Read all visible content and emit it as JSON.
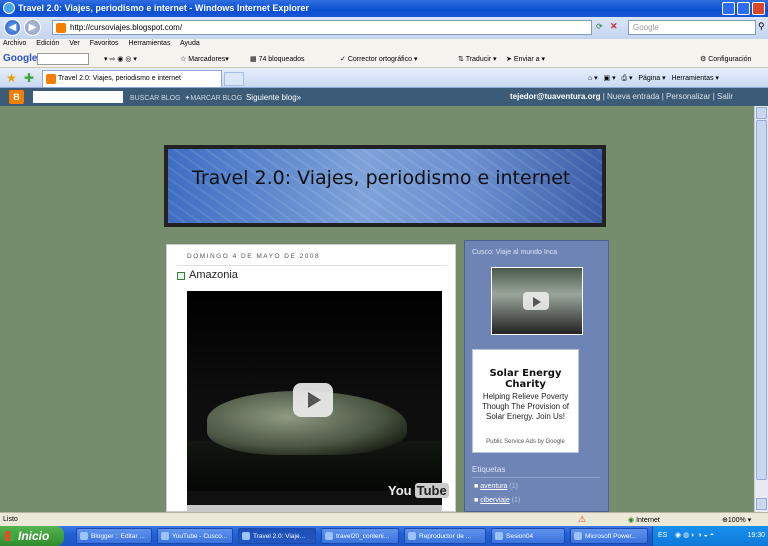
{
  "window": {
    "title": "Travel 2.0: Viajes, periodismo e internet - Windows Internet Explorer"
  },
  "address_bar": {
    "url": "http://cursoviajes.blogspot.com/",
    "search_placeholder": "Google"
  },
  "menu": [
    "Archivo",
    "Edición",
    "Ver",
    "Favoritos",
    "Herramientas",
    "Ayuda"
  ],
  "google_toolbar": {
    "logo": "Google",
    "items": [
      "Marcadores",
      "74 bloqueados",
      "Corrector ortográfico",
      "Traducir",
      "Enviar a"
    ],
    "settings": "Configuración"
  },
  "tab": {
    "label": "Travel 2.0: Viajes, periodismo e internet",
    "right_tools": [
      "Página",
      "Herramientas"
    ]
  },
  "blogger_navbar": {
    "search_button": "BUSCAR BLOG",
    "mark_button": "MARCAR BLOG",
    "next_blog": "Siguiente blog»",
    "user": "tejedor@tuaventura.org",
    "links": [
      "Nueva entrada",
      "Personalizar",
      "Salir"
    ]
  },
  "blog": {
    "title": "Travel 2.0: Viajes, periodismo e internet"
  },
  "post": {
    "date": "DOMINGO 4 DE MAYO DE 2008",
    "title": "Amazonia",
    "video_brand": "You",
    "video_brand_box": "Tube"
  },
  "sidebar": {
    "video_title": "Cusco: Viaje al mundo Inca",
    "ad": {
      "title": "Solar Energy Charity",
      "text": "Helping Relieve Poverty Though The Provision of Solar Energy. Join Us!",
      "footer": "Public Service Ads by Google"
    },
    "labels_heading": "Etiquetas",
    "labels": [
      {
        "name": "aventura",
        "count": "(1)"
      },
      {
        "name": "ciberviaje",
        "count": "(1)"
      }
    ]
  },
  "status_bar": {
    "status": "Listo",
    "zone": "Internet",
    "zoom": "100%"
  },
  "taskbar": {
    "start": "Inicio",
    "tasks": [
      {
        "label": "Blogger :: Editar ...",
        "active": false
      },
      {
        "label": "YouTube - Cusco...",
        "active": false
      },
      {
        "label": "Travel 2.0: Viaje...",
        "active": true
      },
      {
        "label": "travel20_conteni...",
        "active": false
      },
      {
        "label": "Reproductor de ...",
        "active": false
      },
      {
        "label": "Sesion04",
        "active": false
      },
      {
        "label": "Microsoft Power...",
        "active": false
      }
    ],
    "tray_lang": "ES",
    "clock": "19:30"
  }
}
